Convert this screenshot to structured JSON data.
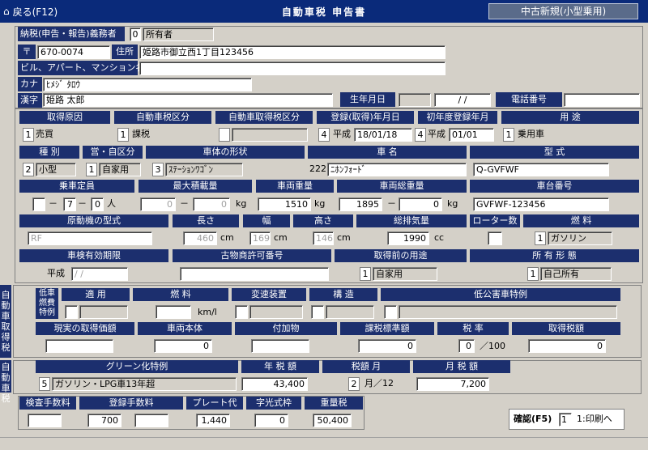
{
  "header": {
    "back_label": "戻る(F12)",
    "title": "自動車税 申告書",
    "mode_label": "中古新規(小型乗用)"
  },
  "taxpayer": {
    "label": "納税(申告・報告)義務者",
    "code": "0",
    "type": "所有者",
    "postal_label": "〒",
    "postal": "670-0074",
    "address_label": "住所",
    "address": "姫路市御立西1丁目123456",
    "building_label": "ビル、アパート、マンション名",
    "building": "",
    "kana_label": "カナ",
    "kana": "ﾋﾒｼﾞ ﾀﾛｳ",
    "kanji_label": "漢字",
    "kanji": "姫路 太郎",
    "birth_label": "生年月日",
    "birth": "/ /",
    "phone_label": "電話番号",
    "phone": ""
  },
  "row1": {
    "headers": [
      "取得原因",
      "自動車税区分",
      "自動車取得税区分",
      "登録(取得)年月日",
      "初年度登録年月",
      "用 途"
    ],
    "acq_cause_code": "1",
    "acq_cause": "売買",
    "tax_class_code": "1",
    "tax_class": "課税",
    "acq_tax_class": "",
    "reg_code": "4",
    "reg_era": "平成",
    "reg_date": "18/01/18",
    "first_code": "4",
    "first_era": "平成",
    "first_date": "01/01",
    "usage_code": "1",
    "usage": "乗用車"
  },
  "row2": {
    "headers": [
      "種 別",
      "営・自区分",
      "車体の形状",
      "車 名",
      "型 式"
    ],
    "kind_code": "2",
    "kind": "小型",
    "biz_code": "1",
    "biz": "自家用",
    "shape_code": "3",
    "shape": "ｽﾃｰｼｮﾝﾜｺﾞﾝ",
    "maker_code": "222",
    "maker": "ﾆﾎﾝﾌｫｰﾄﾞ",
    "model": "Q-GVFWF"
  },
  "row3": {
    "headers": [
      "乗車定員",
      "最大積載量",
      "車両重量",
      "車両総重量",
      "車台番号"
    ],
    "cap_a": "",
    "cap_sep1": "－",
    "cap_b": "7",
    "cap_sep2": "－",
    "cap_c": "0",
    "cap_unit": "人",
    "load_a": "0",
    "load_sep": "－",
    "load_b": "0",
    "load_unit": "kg",
    "weight": "1510",
    "weight_unit": "kg",
    "gross_a": "1895",
    "gross_sep": "－",
    "gross_b": "0",
    "gross_unit": "kg",
    "chassis": "GVFWF-123456"
  },
  "row4": {
    "headers": [
      "原動機の型式",
      "長さ",
      "幅",
      "高さ",
      "総排気量",
      "ローター数",
      "燃 料"
    ],
    "engine": "RF",
    "length": "460",
    "width": "169",
    "height": "146",
    "dim_unit": "cm",
    "displacement": "1990",
    "disp_unit": "cc",
    "rotor": "",
    "fuel_code": "1",
    "fuel": "ガソリン"
  },
  "row5": {
    "headers": [
      "車検有効期限",
      "古物商許可番号",
      "取得前の用途",
      "所 有 形 態"
    ],
    "inspect_era": "平成",
    "inspect": "/ /",
    "antique": "",
    "prior_code": "1",
    "prior": "自家用",
    "own_code": "1",
    "own": "自己所有"
  },
  "acq_section": {
    "side_label": "自動車取得税",
    "lowfuel_label": "低車燃費特例",
    "headers": [
      "適 用",
      "燃 料",
      "変速装置",
      "構 造",
      "低公害車特例"
    ],
    "fuel_unit": "km/l",
    "headers2": [
      "現実の取得価額",
      "車両本体",
      "付加物",
      "課税標準額",
      "税 率",
      "取得税額"
    ],
    "vehicle_body": "0",
    "tax_base": "0",
    "rate": "0",
    "rate_unit": "／100",
    "acq_tax": "0"
  },
  "car_section": {
    "side_label": "自動車税",
    "headers": [
      "グリーン化特例",
      "年 税 額",
      "税額 月",
      "月 税 額"
    ],
    "green_code": "5",
    "green": "ガソリン・LPG車13年超",
    "annual": "43,400",
    "months": "2",
    "months_unit": "月／12",
    "monthly": "7,200"
  },
  "fees": {
    "headers": [
      "検査手数料",
      "登録手数料",
      "プレート代",
      "字光式枠",
      "重量税"
    ],
    "inspect_fee": "",
    "reg_fee": "700",
    "reg_fee2": "",
    "plate": "1,440",
    "frame": "0",
    "weight_tax": "50,400"
  },
  "confirm": {
    "label": "確認(F5)",
    "value": "1",
    "hint": "1:印刷へ"
  }
}
